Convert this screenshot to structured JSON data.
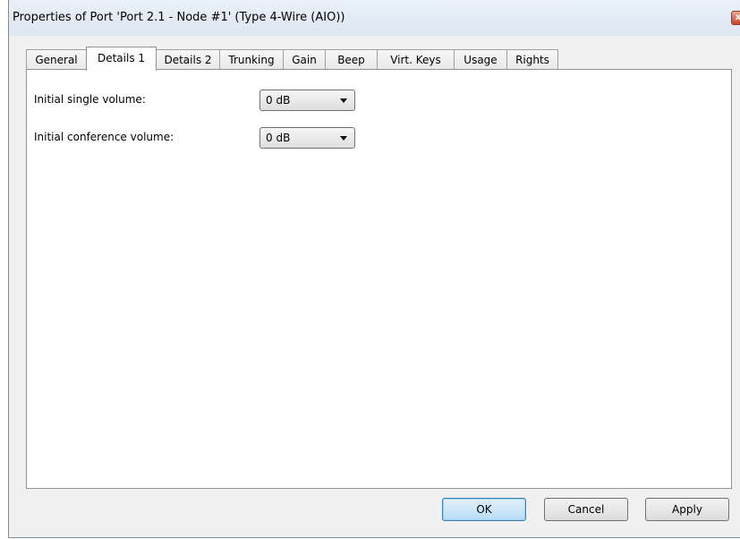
{
  "window": {
    "title": "Properties of Port 'Port 2.1 - Node #1' (Type 4-Wire (AIO))",
    "close_glyph": "x"
  },
  "tabs": [
    {
      "label": "General",
      "selected": false
    },
    {
      "label": "Details 1",
      "selected": true
    },
    {
      "label": "Details 2",
      "selected": false
    },
    {
      "label": "Trunking",
      "selected": false
    },
    {
      "label": "Gain",
      "selected": false
    },
    {
      "label": "Beep",
      "selected": false
    },
    {
      "label": "Virt. Keys",
      "selected": false
    },
    {
      "label": "Usage",
      "selected": false
    },
    {
      "label": "Rights",
      "selected": false
    }
  ],
  "fields": {
    "single_volume": {
      "label": "Initial single volume:",
      "value": "0 dB"
    },
    "conference_volume": {
      "label": "Initial conference volume:",
      "value": "0 dB"
    }
  },
  "buttons": {
    "ok": "OK",
    "cancel": "Cancel",
    "apply": "Apply"
  },
  "icons": {
    "close": "close-icon",
    "dropdown": "chevron-down-icon"
  },
  "colors": {
    "title_bar": "#dde7f2",
    "panel": "#ffffff",
    "default_button": "#b9dcf5",
    "close_button": "#c7432b"
  }
}
